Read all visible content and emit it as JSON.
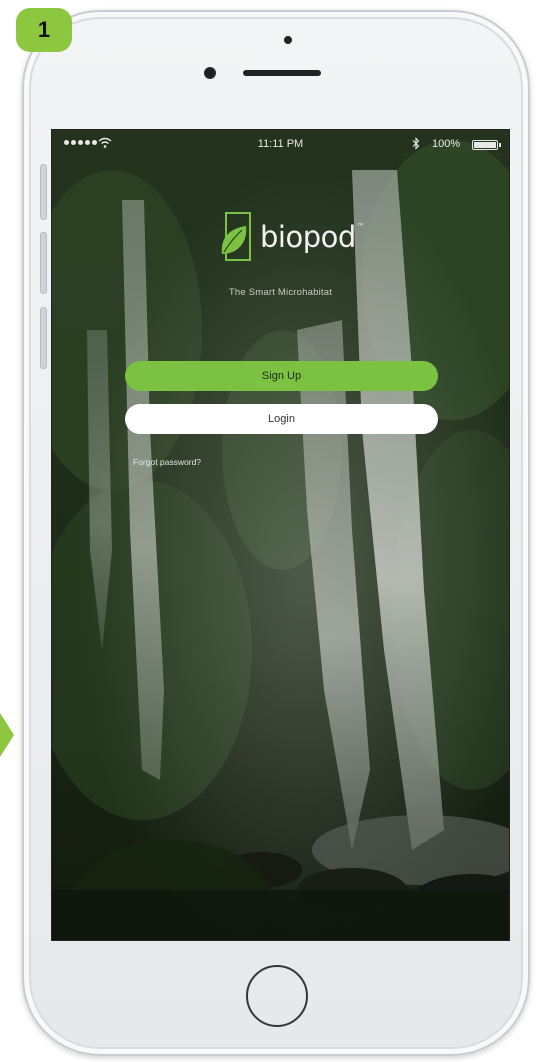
{
  "badge": {
    "step": "1"
  },
  "status_bar": {
    "time": "11:11 PM",
    "battery": "100%"
  },
  "app": {
    "brand": "biopod",
    "trademark": "™",
    "tagline": "The Smart Microhabitat",
    "signup_label": "Sign Up",
    "login_label": "Login",
    "forgot_label": "Forgot password?"
  },
  "colors": {
    "accent": "#8dc63f",
    "signup_button": "#7cc242",
    "login_button": "#ffffff"
  },
  "icons": [
    "leaf-logo-icon",
    "wifi-icon",
    "bluetooth-icon",
    "battery-icon",
    "signal-icon"
  ]
}
